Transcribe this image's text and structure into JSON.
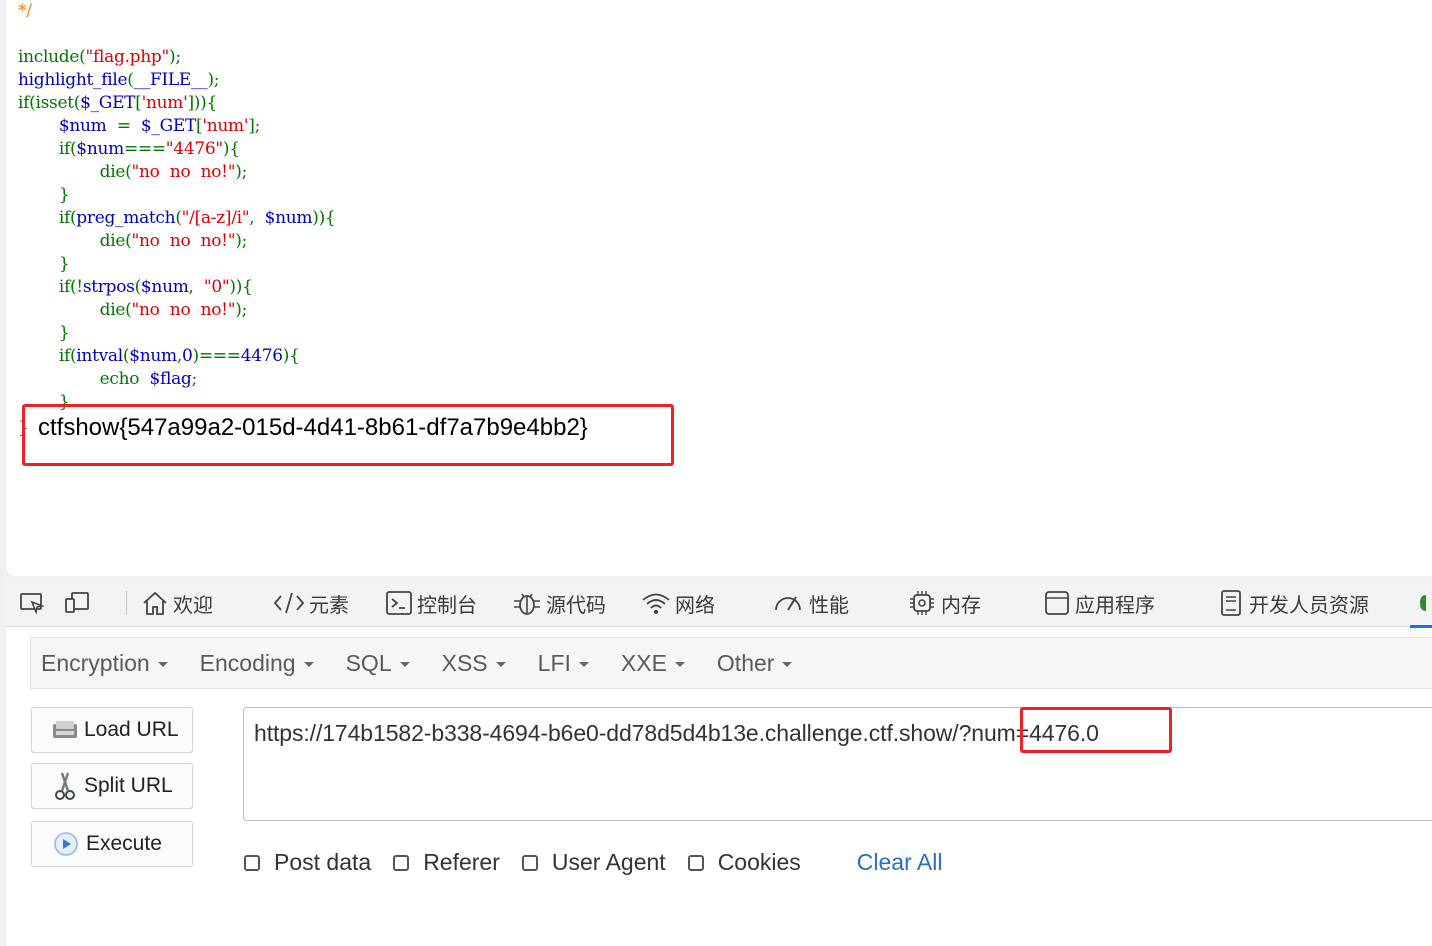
{
  "source_code": [
    [
      {
        "t": "*/",
        "c": "cmt"
      }
    ],
    [],
    [
      {
        "t": "include",
        "c": "kw"
      },
      {
        "t": "(",
        "c": "kw"
      },
      {
        "t": "\"flag.php\"",
        "c": "str"
      },
      {
        "t": ");",
        "c": "kw"
      }
    ],
    [
      {
        "t": "highlight_file",
        "c": "var"
      },
      {
        "t": "(",
        "c": "kw"
      },
      {
        "t": "__FILE__",
        "c": "var"
      },
      {
        "t": ");",
        "c": "kw"
      }
    ],
    [
      {
        "t": "if(isset(",
        "c": "kw"
      },
      {
        "t": "$_GET",
        "c": "var"
      },
      {
        "t": "[",
        "c": "kw"
      },
      {
        "t": "'num'",
        "c": "str"
      },
      {
        "t": "])){",
        "c": "kw"
      }
    ],
    [
      {
        "t": "        ",
        "c": "kw"
      },
      {
        "t": "$num",
        "c": "var"
      },
      {
        "t": "  =  ",
        "c": "kw"
      },
      {
        "t": "$_GET",
        "c": "var"
      },
      {
        "t": "[",
        "c": "kw"
      },
      {
        "t": "'num'",
        "c": "str"
      },
      {
        "t": "];",
        "c": "kw"
      }
    ],
    [
      {
        "t": "        if(",
        "c": "kw"
      },
      {
        "t": "$num",
        "c": "var"
      },
      {
        "t": "===",
        "c": "kw"
      },
      {
        "t": "\"4476\"",
        "c": "str"
      },
      {
        "t": "){",
        "c": "kw"
      }
    ],
    [
      {
        "t": "                die(",
        "c": "kw"
      },
      {
        "t": "\"no  no  no!\"",
        "c": "str"
      },
      {
        "t": ");",
        "c": "kw"
      }
    ],
    [
      {
        "t": "        }",
        "c": "kw"
      }
    ],
    [
      {
        "t": "        if(",
        "c": "kw"
      },
      {
        "t": "preg_match",
        "c": "var"
      },
      {
        "t": "(",
        "c": "kw"
      },
      {
        "t": "\"/[a-z]/i\"",
        "c": "str"
      },
      {
        "t": ",  ",
        "c": "kw"
      },
      {
        "t": "$num",
        "c": "var"
      },
      {
        "t": ")){",
        "c": "kw"
      }
    ],
    [
      {
        "t": "                die(",
        "c": "kw"
      },
      {
        "t": "\"no  no  no!\"",
        "c": "str"
      },
      {
        "t": ");",
        "c": "kw"
      }
    ],
    [
      {
        "t": "        }",
        "c": "kw"
      }
    ],
    [
      {
        "t": "        if(!",
        "c": "kw"
      },
      {
        "t": "strpos",
        "c": "var"
      },
      {
        "t": "(",
        "c": "kw"
      },
      {
        "t": "$num",
        "c": "var"
      },
      {
        "t": ",  ",
        "c": "kw"
      },
      {
        "t": "\"0\"",
        "c": "str"
      },
      {
        "t": ")){",
        "c": "kw"
      }
    ],
    [
      {
        "t": "                die(",
        "c": "kw"
      },
      {
        "t": "\"no  no  no!\"",
        "c": "str"
      },
      {
        "t": ");",
        "c": "kw"
      }
    ],
    [
      {
        "t": "        }",
        "c": "kw"
      }
    ],
    [
      {
        "t": "        if(",
        "c": "kw"
      },
      {
        "t": "intval",
        "c": "var"
      },
      {
        "t": "(",
        "c": "kw"
      },
      {
        "t": "$num",
        "c": "var"
      },
      {
        "t": ",",
        "c": "kw"
      },
      {
        "t": "0",
        "c": "var"
      },
      {
        "t": ")===",
        "c": "kw"
      },
      {
        "t": "4476",
        "c": "var"
      },
      {
        "t": "){",
        "c": "kw"
      }
    ],
    [
      {
        "t": "                echo  ",
        "c": "kw"
      },
      {
        "t": "$flag",
        "c": "var"
      },
      {
        "t": ";",
        "c": "kw"
      }
    ],
    [
      {
        "t": "        }",
        "c": "kw"
      }
    ]
  ],
  "flag_output": "ctfshow{547a99a2-015d-4d41-8b61-df7a7b9e4bb2}",
  "devtools": {
    "tabs": [
      "欢迎",
      "元素",
      "控制台",
      "源代码",
      "网络",
      "性能",
      "内存",
      "应用程序",
      "开发人员资源"
    ]
  },
  "hackbar": {
    "menus": [
      "Encryption",
      "Encoding",
      "SQL",
      "XSS",
      "LFI",
      "XXE",
      "Other"
    ],
    "load_url": "Load URL",
    "split_url": "Split URL",
    "execute": "Execute",
    "url": "https://174b1582-b338-4694-b6e0-dd78d5d4b13e.challenge.ctf.show/?num=4476.0",
    "options": [
      "Post data",
      "Referer",
      "User Agent",
      "Cookies"
    ],
    "clear_all": "Clear All"
  },
  "colors": {
    "highlight_box": "#ee2222",
    "php_keyword": "#007700",
    "php_string": "#dd0000",
    "php_variable": "#0000bb",
    "php_comment": "#ff8000",
    "link": "#2a6fbe"
  }
}
